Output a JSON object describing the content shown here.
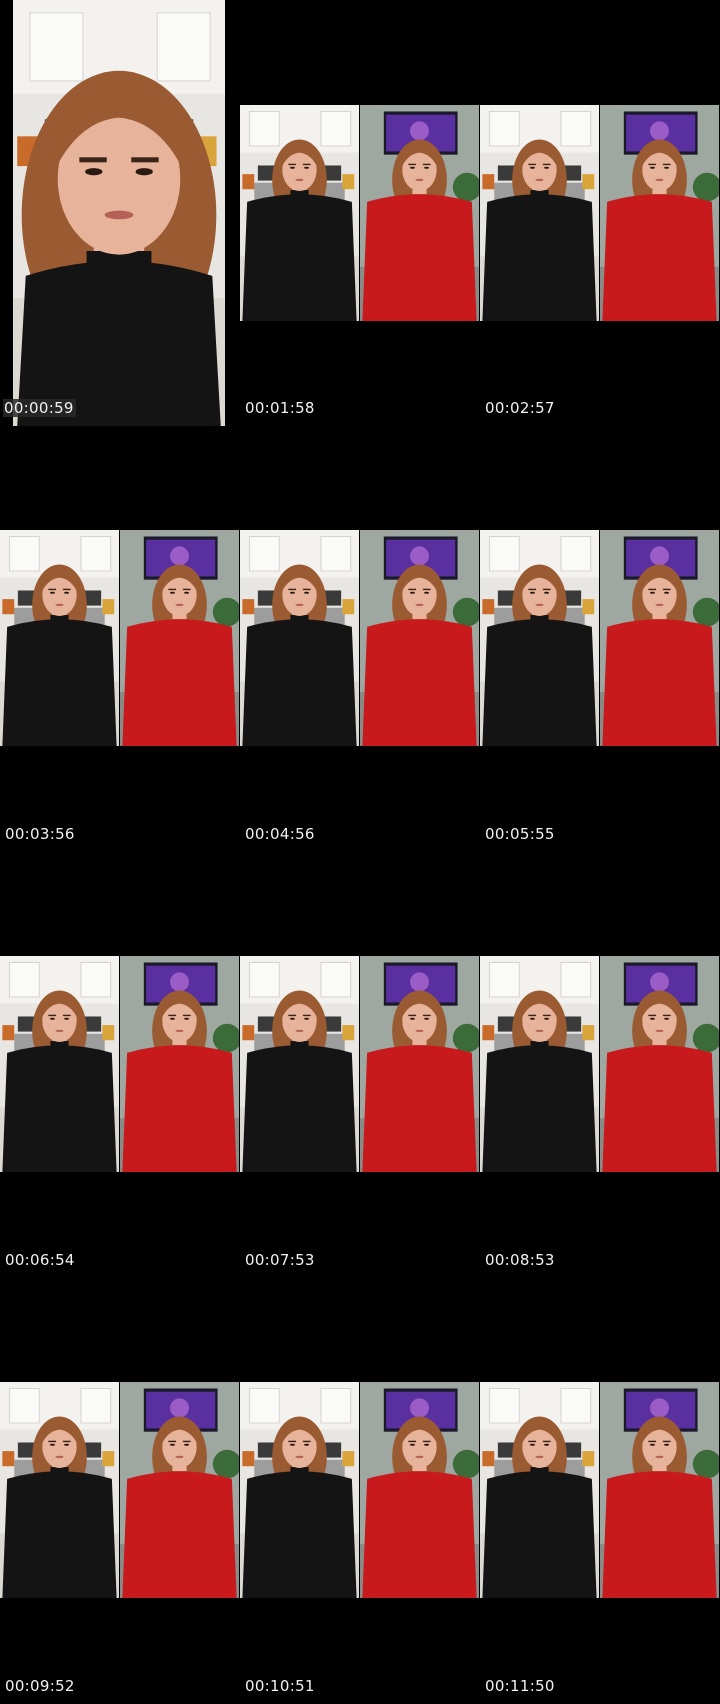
{
  "contact_sheet": {
    "rows": [
      {
        "cells": [
          {
            "timestamp": "00:00:59",
            "frames": [
              {
                "shirt": "black",
                "bg": "kitchen",
                "style": "closeup"
              }
            ]
          },
          {
            "timestamp": "00:01:58",
            "frames": [
              {
                "shirt": "black",
                "bg": "kitchen"
              },
              {
                "shirt": "red",
                "bg": "livingroom"
              }
            ]
          },
          {
            "timestamp": "00:02:57",
            "frames": [
              {
                "shirt": "black",
                "bg": "kitchen"
              },
              {
                "shirt": "red",
                "bg": "livingroom"
              }
            ]
          }
        ]
      },
      {
        "cells": [
          {
            "timestamp": "00:03:56",
            "frames": [
              {
                "shirt": "black",
                "bg": "kitchen"
              },
              {
                "shirt": "red",
                "bg": "livingroom"
              }
            ]
          },
          {
            "timestamp": "00:04:56",
            "frames": [
              {
                "shirt": "black",
                "bg": "kitchen"
              },
              {
                "shirt": "red",
                "bg": "livingroom"
              }
            ]
          },
          {
            "timestamp": "00:05:55",
            "frames": [
              {
                "shirt": "black",
                "bg": "kitchen"
              },
              {
                "shirt": "red",
                "bg": "livingroom"
              }
            ]
          }
        ]
      },
      {
        "cells": [
          {
            "timestamp": "00:06:54",
            "frames": [
              {
                "shirt": "black",
                "bg": "kitchen"
              },
              {
                "shirt": "red",
                "bg": "livingroom"
              }
            ]
          },
          {
            "timestamp": "00:07:53",
            "frames": [
              {
                "shirt": "black",
                "bg": "kitchen"
              },
              {
                "shirt": "red",
                "bg": "livingroom"
              }
            ]
          },
          {
            "timestamp": "00:08:53",
            "frames": [
              {
                "shirt": "black",
                "bg": "kitchen"
              },
              {
                "shirt": "red",
                "bg": "livingroom"
              }
            ]
          }
        ]
      },
      {
        "cells": [
          {
            "timestamp": "00:09:52",
            "frames": [
              {
                "shirt": "black",
                "bg": "kitchen"
              },
              {
                "shirt": "red",
                "bg": "livingroom"
              }
            ]
          },
          {
            "timestamp": "00:10:51",
            "frames": [
              {
                "shirt": "black",
                "bg": "kitchen"
              },
              {
                "shirt": "red",
                "bg": "livingroom"
              }
            ]
          },
          {
            "timestamp": "00:11:50",
            "frames": [
              {
                "shirt": "black",
                "bg": "kitchen"
              },
              {
                "shirt": "red",
                "bg": "livingroom"
              }
            ]
          }
        ]
      }
    ]
  },
  "colors": {
    "background": "#000000",
    "timestamp_text": "#f2f2f2",
    "shirt_black": "#141414",
    "shirt_red": "#c8191c",
    "hair": "#9a5a32",
    "skin": "#e7b39a",
    "kitchen_wall": "#e8e6e2",
    "livingroom_wall": "#9ea7a0",
    "tv_screen": "#5a2fa0"
  }
}
